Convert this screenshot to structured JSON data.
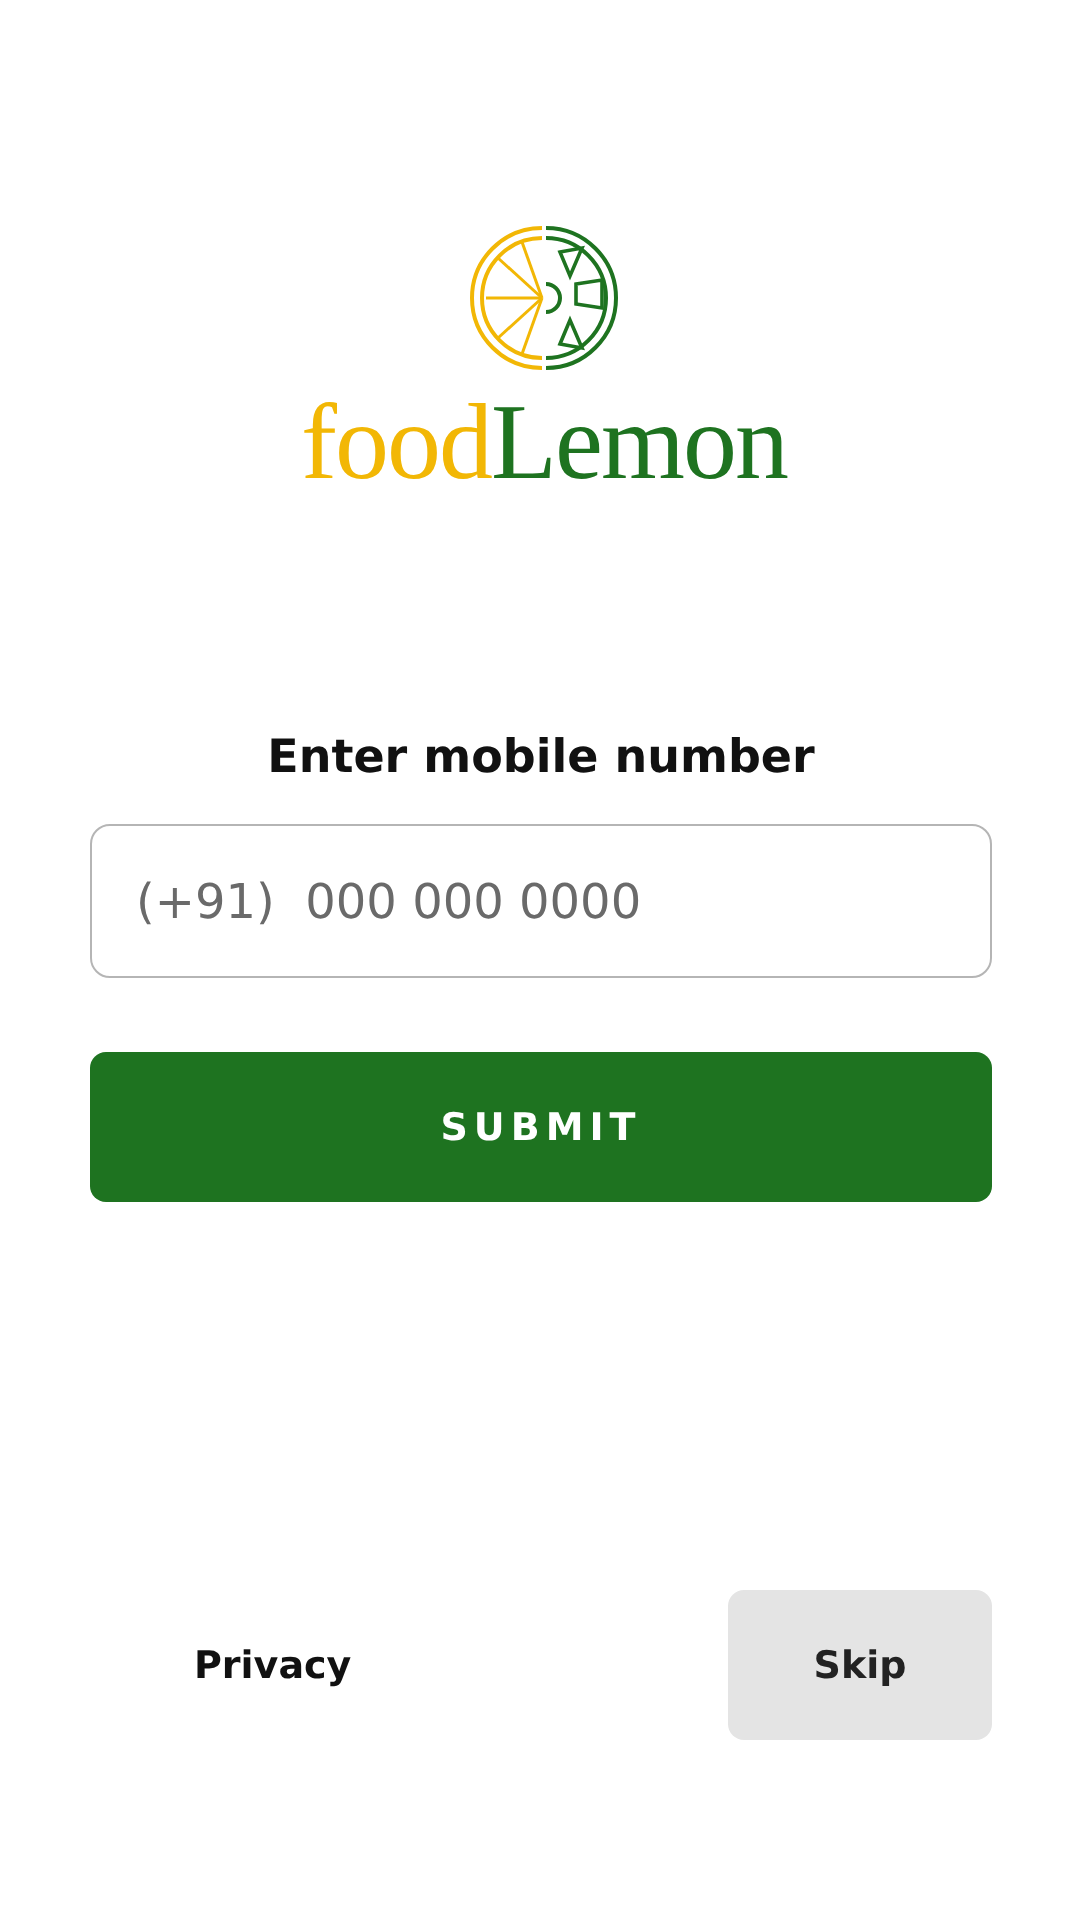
{
  "logo": {
    "parts": [
      {
        "text": "food",
        "color": "#f2b705"
      },
      {
        "text": "Lemon",
        "color": "#1e7320"
      }
    ]
  },
  "form": {
    "label": "Enter mobile number",
    "phone_field": {
      "placeholder": "(+91)  000 000 0000"
    },
    "submit": "SUBMIT"
  },
  "footer": {
    "privacy_link": "Privacy",
    "skip_button": "Skip"
  }
}
